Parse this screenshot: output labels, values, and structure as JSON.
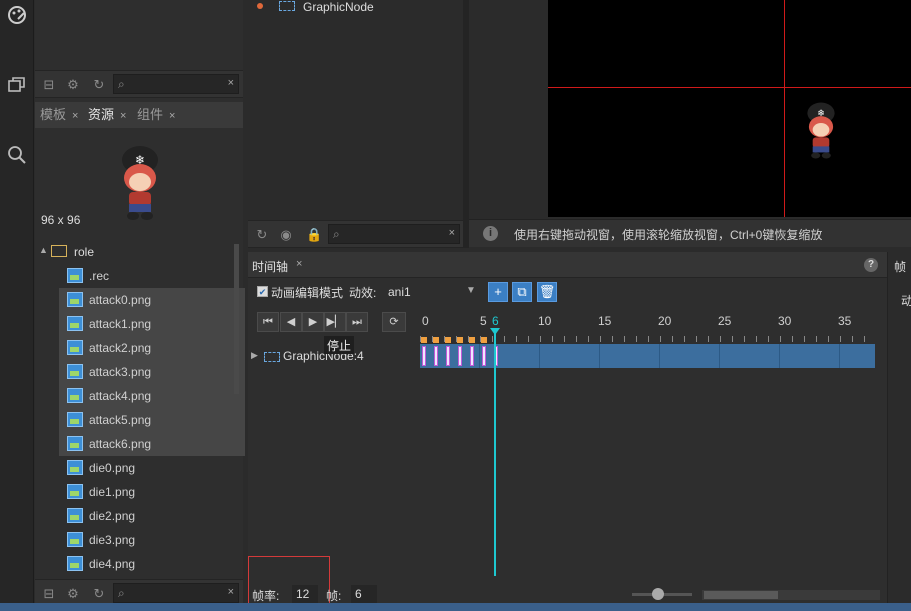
{
  "hierarchy": {
    "node_label": "GraphicNode"
  },
  "assets": {
    "tabs": [
      {
        "label": "模板",
        "close": "×"
      },
      {
        "label": "资源",
        "close": "×"
      },
      {
        "label": "组件",
        "close": "×"
      }
    ],
    "preview_size": "96 x 96",
    "folder": "role",
    "files": [
      ".rec",
      "attack0.png",
      "attack1.png",
      "attack2.png",
      "attack3.png",
      "attack4.png",
      "attack5.png",
      "attack6.png",
      "die0.png",
      "die1.png",
      "die2.png",
      "die3.png",
      "die4.png"
    ],
    "search_close": "×"
  },
  "scene": {
    "status_text": "使用右键拖动视窗，使用滚轮缩放视窗，Ctrl+0键恢复缩放",
    "info_icon": "info-icon"
  },
  "timeline": {
    "tab_label": "时间轴",
    "tab_close": "×",
    "anim_mode_label": "动画编辑模式",
    "anim_mode_checked": true,
    "effect_label": "动效:",
    "effect_value": "ani1",
    "ruler_ticks": [
      "0",
      "5",
      "6",
      "10",
      "15",
      "20",
      "25",
      "30",
      "35"
    ],
    "current_frame_marker": "6",
    "tooltip": "停止",
    "track_label": "GraphicNode:4",
    "fps_label": "帧率:",
    "fps_value": "12",
    "frame_label": "帧:",
    "frame_value": "6",
    "help": "?"
  },
  "right_panel": {
    "label1": "帧",
    "label2": "动"
  },
  "colors": {
    "accent_blue": "#3b7fc4",
    "playhead": "#1ec8d0",
    "crosshair": "#d01a1a",
    "highlight_box": "#d43a3a"
  }
}
